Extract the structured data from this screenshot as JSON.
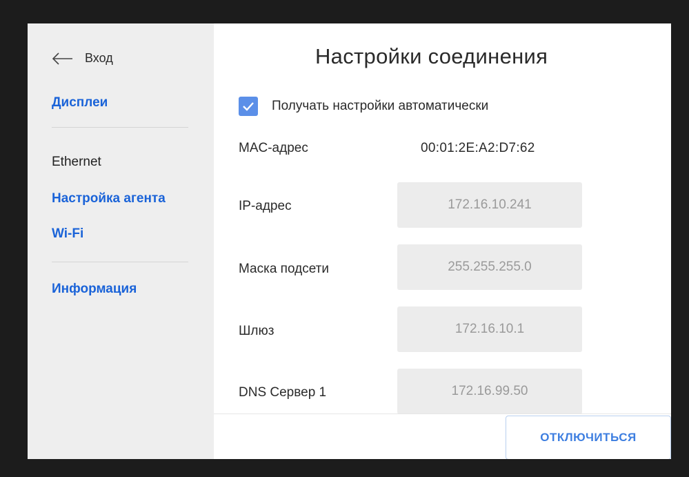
{
  "sidebar": {
    "back_label": "Вход",
    "items": [
      {
        "label": "Дисплеи"
      },
      {
        "label": "Ethernet"
      },
      {
        "label": "Настройка агента"
      },
      {
        "label": "Wi-Fi"
      },
      {
        "label": "Информация"
      }
    ]
  },
  "main": {
    "title": "Настройки соединения",
    "auto_settings": {
      "label": "Получать настройки автоматически",
      "checked": true
    },
    "mac": {
      "label": "MAC-адрес",
      "value": "00:01:2E:A2:D7:62"
    },
    "fields": [
      {
        "label": "IP-адрес",
        "value": "172.16.10.241"
      },
      {
        "label": "Маска подсети",
        "value": "255.255.255.0"
      },
      {
        "label": "Шлюз",
        "value": "172.16.10.1"
      },
      {
        "label": "DNS Сервер 1",
        "value": "172.16.99.50"
      }
    ]
  },
  "footer": {
    "disconnect_label": "ОТКЛЮЧИТЬСЯ"
  },
  "colors": {
    "accent": "#1a63d8",
    "checkbox": "#5b8fe8",
    "sidebar_bg": "#eeeeee",
    "input_bg": "#ececec"
  },
  "icons": {
    "back": "arrow-left-icon",
    "check": "checkmark-icon"
  }
}
